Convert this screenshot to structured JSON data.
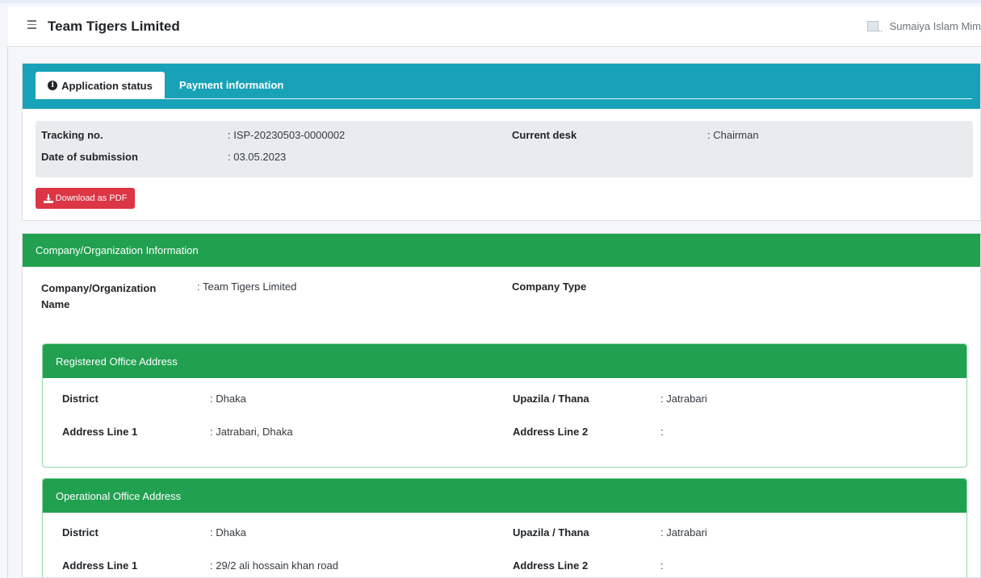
{
  "header": {
    "brand": "Team Tigers Limited",
    "user_name": "Sumaiya Islam Mim"
  },
  "tabs": [
    {
      "label": "Application status",
      "active": true
    },
    {
      "label": "Payment information",
      "active": false
    }
  ],
  "status": {
    "tracking_label": "Tracking no.",
    "tracking_value": ": ISP-20230503-0000002",
    "date_label": "Date of submission",
    "date_value": ": 03.05.2023",
    "desk_label": "Current desk",
    "desk_value": ": Chairman"
  },
  "pdf_button": {
    "label": "Download as PDF"
  },
  "company": {
    "title": "Company/Organization Information",
    "name_label_line1": "Company/Organization",
    "name_label_line2": "Name",
    "name_value": ": Team Tigers Limited",
    "type_label": "Company Type"
  },
  "registered_address": {
    "title": "Registered Office Address",
    "district_label": "District",
    "district_value": ": Dhaka",
    "upazila_label": "Upazila / Thana",
    "upazila_value": ": Jatrabari",
    "line1_label": "Address Line 1",
    "line1_value": ": Jatrabari, Dhaka",
    "line2_label": "Address Line 2",
    "line2_value": ":"
  },
  "operational_address": {
    "title": "Operational Office Address",
    "district_label": "District",
    "district_value": ": Dhaka",
    "upazila_label": "Upazila / Thana",
    "upazila_value": ": Jatrabari",
    "line1_label": "Address Line 1",
    "line1_value": ": 29/2 ali hossain khan road",
    "line2_label": "Address Line 2",
    "line2_value": ":"
  },
  "colors": {
    "tabbar": "#17a2b8",
    "card_header_green": "#21a050",
    "pdf_button": "#dc3545"
  }
}
